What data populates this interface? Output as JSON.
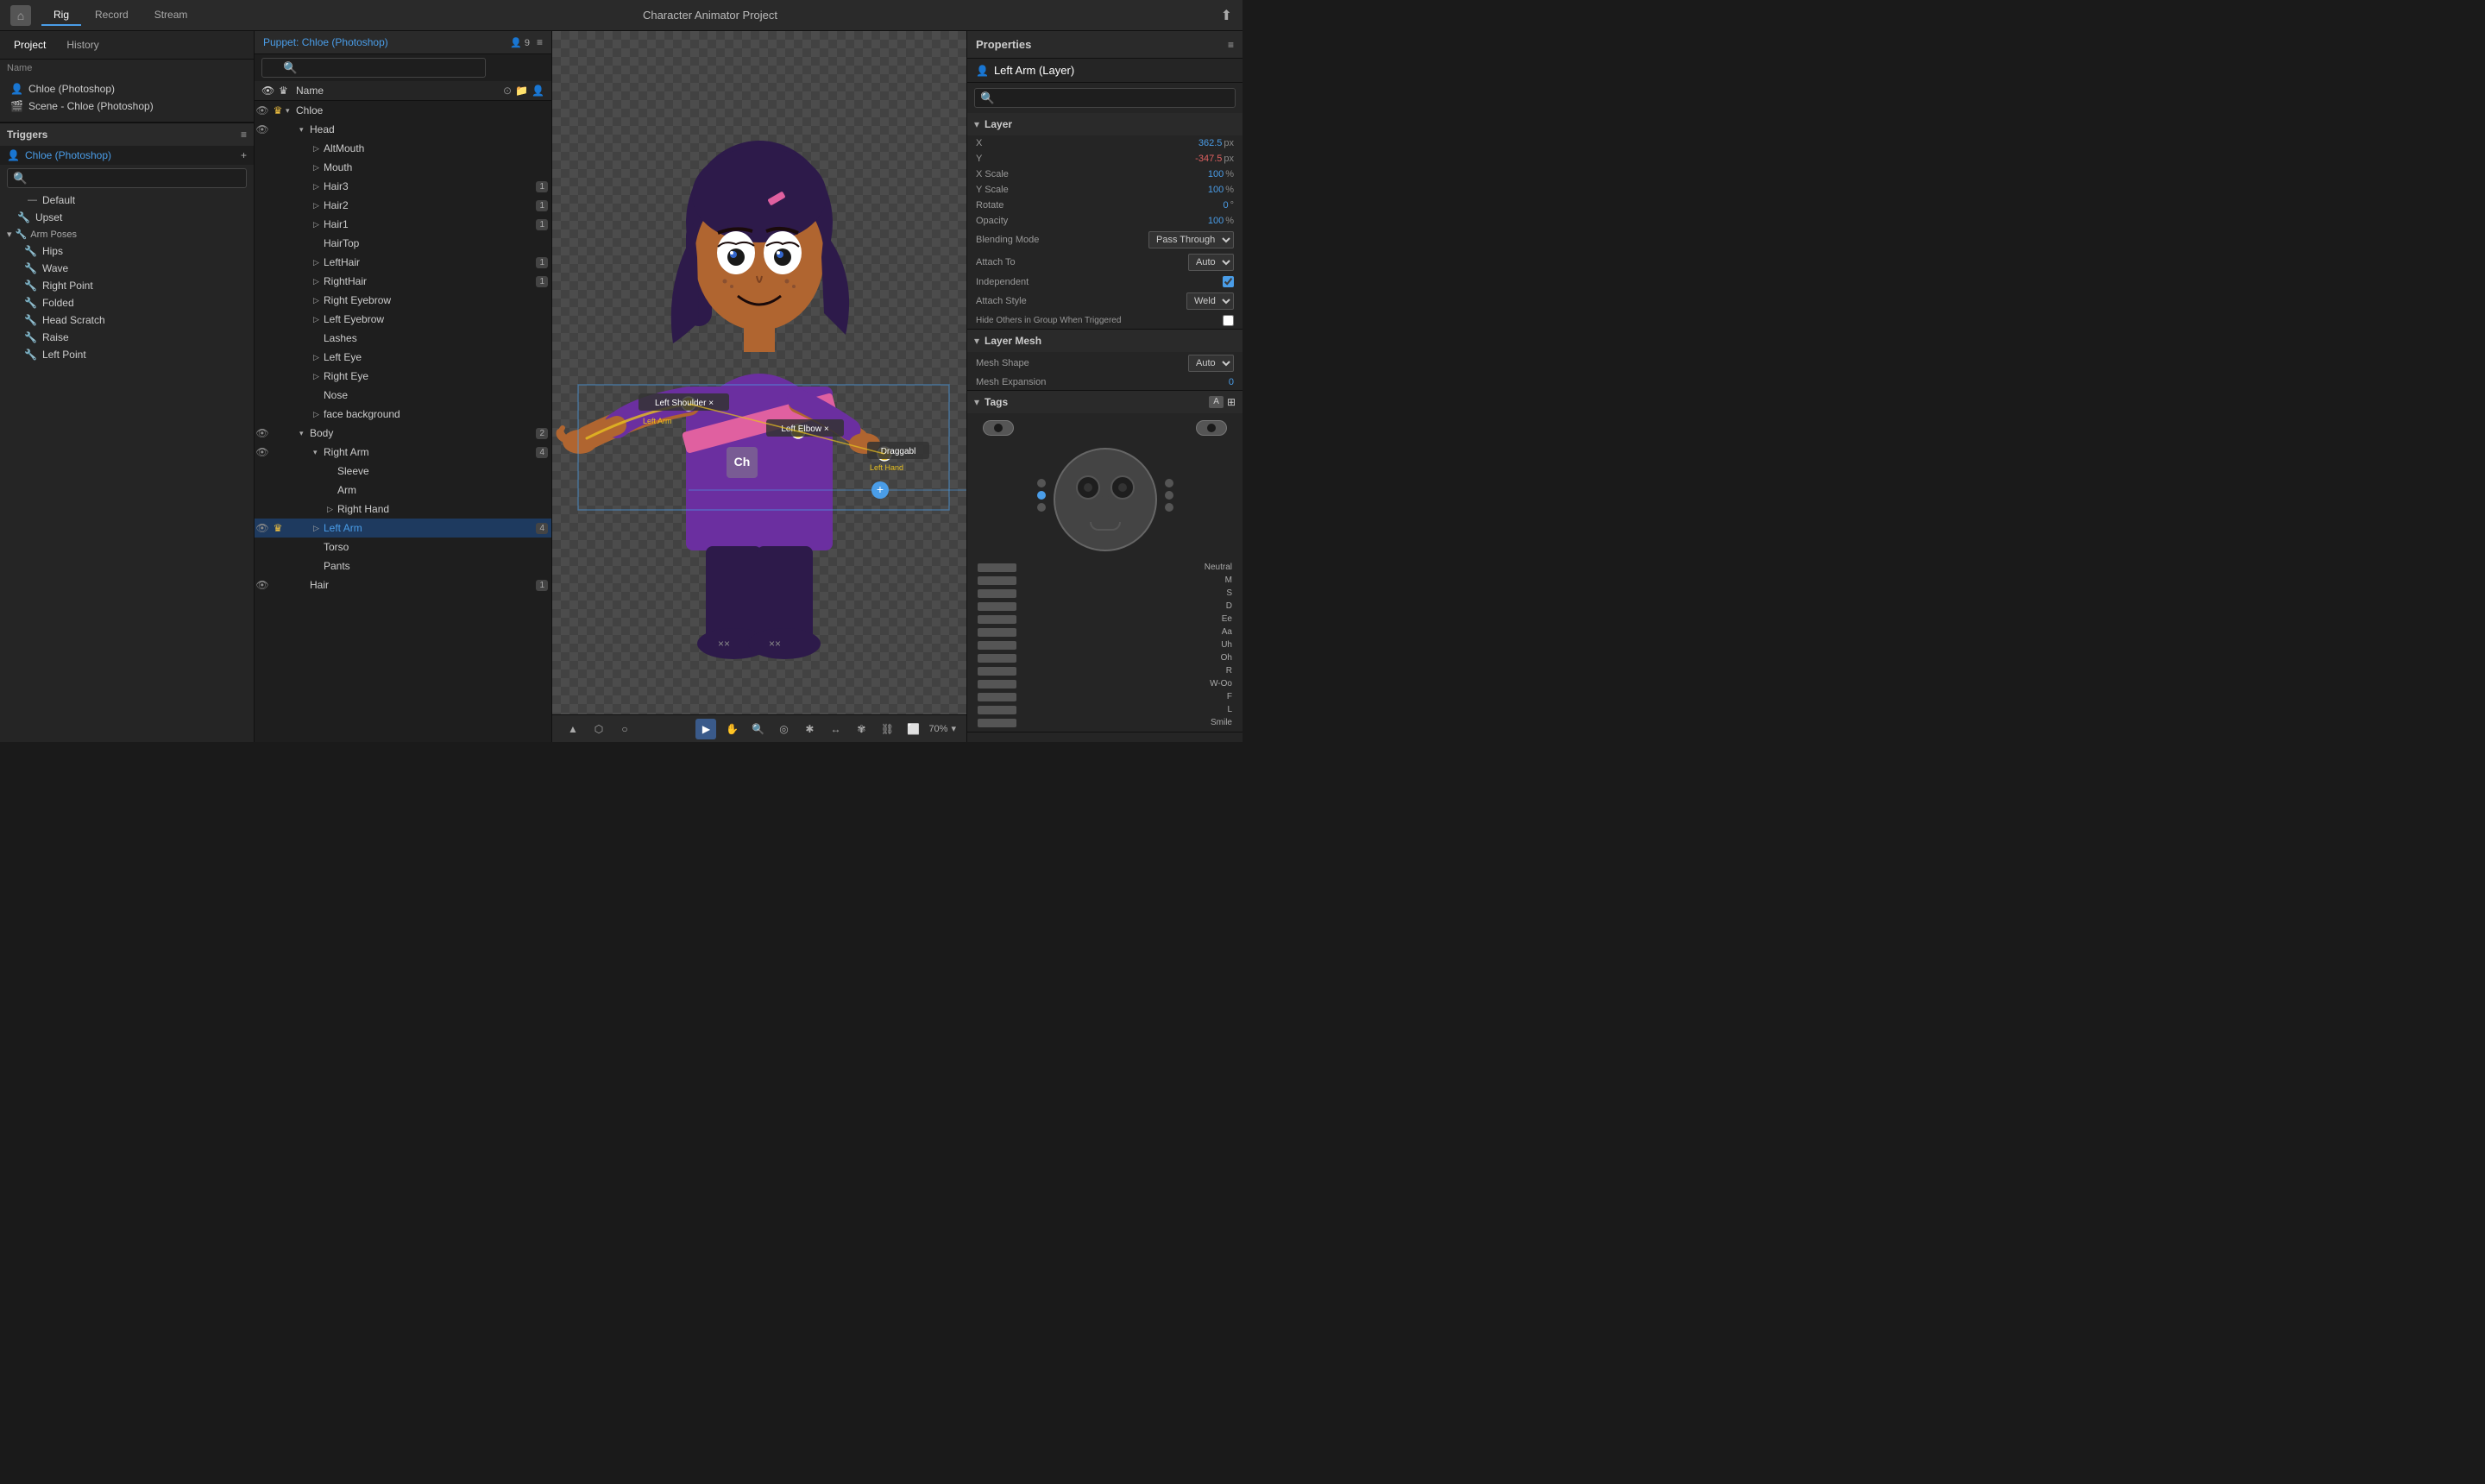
{
  "topbar": {
    "home_icon": "⌂",
    "tabs": [
      {
        "label": "Rig",
        "active": true
      },
      {
        "label": "Record",
        "active": false
      },
      {
        "label": "Stream",
        "active": false
      }
    ],
    "title": "Character Animator Project",
    "export_icon": "⬆"
  },
  "left": {
    "project_tabs": [
      {
        "label": "Project",
        "active": true
      },
      {
        "label": "History",
        "active": false
      }
    ],
    "name_label": "Name",
    "items": [
      {
        "icon": "👤",
        "label": "Chloe (Photoshop)"
      },
      {
        "icon": "🎬",
        "label": "Scene - Chloe (Photoshop)"
      }
    ],
    "triggers": {
      "title": "Triggers",
      "add_icon": "+",
      "puppet_label": "Chloe (Photoshop)",
      "items": [
        {
          "label": "Default",
          "indent": 1
        },
        {
          "label": "Upset",
          "indent": 1
        },
        {
          "label": "Arm Poses",
          "indent": 0,
          "group": true
        },
        {
          "label": "Hips",
          "indent": 2
        },
        {
          "label": "Wave",
          "indent": 2
        },
        {
          "label": "Right Point",
          "indent": 2
        },
        {
          "label": "Folded",
          "indent": 2
        },
        {
          "label": "Head Scratch",
          "indent": 2
        },
        {
          "label": "Raise",
          "indent": 2
        },
        {
          "label": "Left Point",
          "indent": 2
        }
      ]
    }
  },
  "puppet": {
    "title": "Puppet: Chloe (Photoshop)",
    "menu_icon": "≡",
    "avatar_count": "9",
    "search_placeholder": "🔍",
    "col_name": "Name",
    "tree": [
      {
        "label": "Chloe",
        "depth": 0,
        "eye": true,
        "crown": true,
        "arrow": "▾",
        "badge": ""
      },
      {
        "label": "Head",
        "depth": 1,
        "eye": true,
        "crown": false,
        "arrow": "▾",
        "badge": ""
      },
      {
        "label": "AltMouth",
        "depth": 2,
        "eye": false,
        "crown": false,
        "arrow": "▷",
        "badge": ""
      },
      {
        "label": "Mouth",
        "depth": 2,
        "eye": false,
        "crown": false,
        "arrow": "▷",
        "badge": ""
      },
      {
        "label": "Hair3",
        "depth": 2,
        "eye": false,
        "crown": false,
        "arrow": "▷",
        "badge": "1"
      },
      {
        "label": "Hair2",
        "depth": 2,
        "eye": false,
        "crown": false,
        "arrow": "▷",
        "badge": "1"
      },
      {
        "label": "Hair1",
        "depth": 2,
        "eye": false,
        "crown": false,
        "arrow": "▷",
        "badge": "1"
      },
      {
        "label": "HairTop",
        "depth": 2,
        "eye": false,
        "crown": false,
        "arrow": "",
        "badge": ""
      },
      {
        "label": "LeftHair",
        "depth": 2,
        "eye": false,
        "crown": false,
        "arrow": "▷",
        "badge": "1"
      },
      {
        "label": "RightHair",
        "depth": 2,
        "eye": false,
        "crown": false,
        "arrow": "▷",
        "badge": "1"
      },
      {
        "label": "Right Eyebrow",
        "depth": 2,
        "eye": false,
        "crown": false,
        "arrow": "▷",
        "badge": ""
      },
      {
        "label": "Left Eyebrow",
        "depth": 2,
        "eye": false,
        "crown": false,
        "arrow": "▷",
        "badge": ""
      },
      {
        "label": "Lashes",
        "depth": 2,
        "eye": false,
        "crown": false,
        "arrow": "",
        "badge": ""
      },
      {
        "label": "Left Eye",
        "depth": 2,
        "eye": false,
        "crown": false,
        "arrow": "▷",
        "badge": ""
      },
      {
        "label": "Right Eye",
        "depth": 2,
        "eye": false,
        "crown": false,
        "arrow": "▷",
        "badge": ""
      },
      {
        "label": "Nose",
        "depth": 2,
        "eye": false,
        "crown": false,
        "arrow": "",
        "badge": ""
      },
      {
        "label": "face background",
        "depth": 2,
        "eye": false,
        "crown": false,
        "arrow": "▷",
        "badge": ""
      },
      {
        "label": "Body",
        "depth": 1,
        "eye": true,
        "crown": false,
        "arrow": "▾",
        "badge": "2"
      },
      {
        "label": "Right Arm",
        "depth": 2,
        "eye": true,
        "crown": false,
        "arrow": "▾",
        "badge": "4"
      },
      {
        "label": "Sleeve",
        "depth": 3,
        "eye": false,
        "crown": false,
        "arrow": "",
        "badge": ""
      },
      {
        "label": "Arm",
        "depth": 3,
        "eye": false,
        "crown": false,
        "arrow": "",
        "badge": ""
      },
      {
        "label": "Right Hand",
        "depth": 3,
        "eye": false,
        "crown": false,
        "arrow": "▷",
        "badge": ""
      },
      {
        "label": "Left Arm",
        "depth": 2,
        "eye": true,
        "crown": true,
        "arrow": "▷",
        "badge": "4",
        "selected": true,
        "blue": true
      },
      {
        "label": "Torso",
        "depth": 2,
        "eye": false,
        "crown": false,
        "arrow": "",
        "badge": ""
      },
      {
        "label": "Pants",
        "depth": 2,
        "eye": false,
        "crown": false,
        "arrow": "",
        "badge": ""
      },
      {
        "label": "Hair",
        "depth": 1,
        "eye": true,
        "crown": false,
        "arrow": "",
        "badge": "1"
      }
    ]
  },
  "canvas": {
    "toolbar": {
      "left_tools": [
        "▲",
        "⬡",
        "○"
      ],
      "right_tools": [
        "▶",
        "✋",
        "🔍",
        "◎",
        "✱",
        "↔",
        "✾",
        "⛓",
        "⬜"
      ],
      "zoom": "70%"
    },
    "shoulder_label": "Left Shoulder",
    "arm_label": "Left Arm",
    "elbow_label": "Left Elbow",
    "drag_label": "Left Hand",
    "draggable_label": "Draggabl"
  },
  "properties": {
    "title": "Properties",
    "menu_icon": "≡",
    "layer_icon": "👤",
    "layer_name": "Left Arm (Layer)",
    "search_placeholder": "🔍",
    "layer_section": {
      "title": "Layer",
      "x_label": "X",
      "x_value": "362.5",
      "x_unit": "px",
      "y_label": "Y",
      "y_value": "-347.5",
      "y_unit": "px",
      "x_scale_label": "X Scale",
      "x_scale_value": "100",
      "x_scale_unit": "%",
      "y_scale_label": "Y Scale",
      "y_scale_value": "100",
      "y_scale_unit": "%",
      "rotate_label": "Rotate",
      "rotate_value": "0",
      "rotate_unit": "°",
      "opacity_label": "Opacity",
      "opacity_value": "100",
      "opacity_unit": "%",
      "blending_mode_label": "Blending Mode",
      "blending_mode_value": "Pass Through",
      "attach_to_label": "Attach To",
      "attach_to_value": "Auto",
      "independent_label": "Independent",
      "attach_style_label": "Attach Style",
      "attach_style_value": "Weld",
      "hide_others_label": "Hide Others in Group When Triggered"
    },
    "mesh_section": {
      "title": "Layer Mesh",
      "mesh_shape_label": "Mesh Shape",
      "mesh_shape_value": "Auto",
      "mesh_expansion_label": "Mesh Expansion",
      "mesh_expansion_value": "0"
    },
    "tags_section": {
      "title": "Tags",
      "btn_a": "A",
      "btn_grid": "⊞"
    },
    "visemes": [
      {
        "label": "Neutral"
      },
      {
        "label": "M"
      },
      {
        "label": "S"
      },
      {
        "label": "D"
      },
      {
        "label": "Ee"
      },
      {
        "label": "Aa"
      },
      {
        "label": "Uh"
      },
      {
        "label": "Oh"
      },
      {
        "label": "R"
      },
      {
        "label": "W-Oo"
      },
      {
        "label": "F"
      },
      {
        "label": "L"
      },
      {
        "label": "Smile"
      }
    ]
  }
}
